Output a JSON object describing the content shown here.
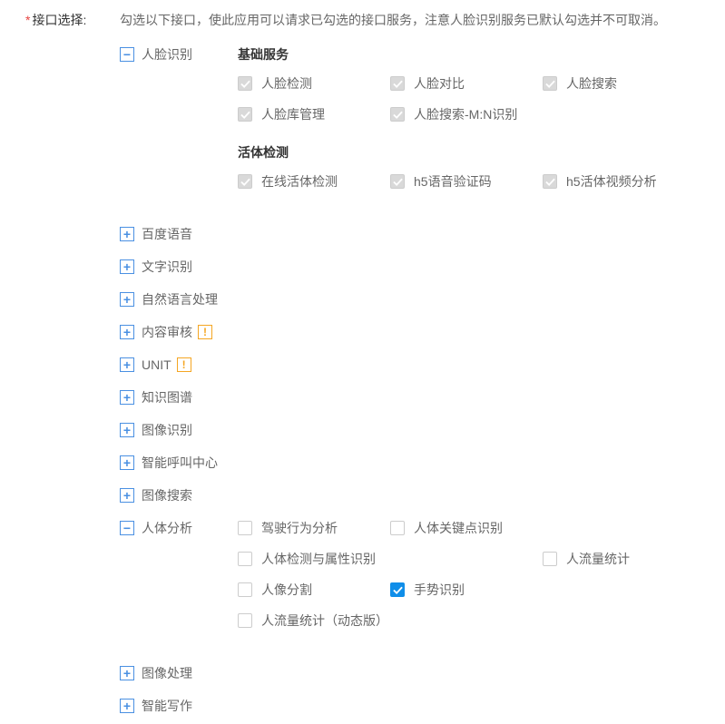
{
  "label": "接口选择:",
  "description": "勾选以下接口，使此应用可以请求已勾选的接口服务，注意人脸识别服务已默认勾选并不可取消。",
  "categories": [
    {
      "name": "人脸识别",
      "expanded": true,
      "warn": false,
      "groups": [
        {
          "title": "基础服务",
          "options": [
            {
              "label": "人脸检测",
              "state": "disabled-checked",
              "wide": false
            },
            {
              "label": "人脸对比",
              "state": "disabled-checked",
              "wide": false
            },
            {
              "label": "人脸搜索",
              "state": "disabled-checked",
              "wide": false
            },
            {
              "label": "人脸库管理",
              "state": "disabled-checked",
              "wide": false
            },
            {
              "label": "人脸搜索-M:N识别",
              "state": "disabled-checked",
              "wide": false
            }
          ]
        },
        {
          "title": "活体检测",
          "options": [
            {
              "label": "在线活体检测",
              "state": "disabled-checked",
              "wide": false
            },
            {
              "label": "h5语音验证码",
              "state": "disabled-checked",
              "wide": false
            },
            {
              "label": "h5活体视频分析",
              "state": "disabled-checked",
              "wide": false
            }
          ]
        }
      ]
    },
    {
      "name": "百度语音",
      "expanded": false,
      "warn": false,
      "groups": []
    },
    {
      "name": "文字识别",
      "expanded": false,
      "warn": false,
      "groups": []
    },
    {
      "name": "自然语言处理",
      "expanded": false,
      "warn": false,
      "groups": []
    },
    {
      "name": "内容审核",
      "expanded": false,
      "warn": true,
      "groups": []
    },
    {
      "name": "UNIT",
      "expanded": false,
      "warn": true,
      "groups": []
    },
    {
      "name": "知识图谱",
      "expanded": false,
      "warn": false,
      "groups": []
    },
    {
      "name": "图像识别",
      "expanded": false,
      "warn": false,
      "groups": []
    },
    {
      "name": "智能呼叫中心",
      "expanded": false,
      "warn": false,
      "groups": []
    },
    {
      "name": "图像搜索",
      "expanded": false,
      "warn": false,
      "groups": []
    },
    {
      "name": "人体分析",
      "expanded": true,
      "warn": false,
      "groups": [
        {
          "title": "",
          "options": [
            {
              "label": "驾驶行为分析",
              "state": "unchecked",
              "wide": false
            },
            {
              "label": "人体关键点识别",
              "state": "unchecked",
              "wide": false
            },
            {
              "label": "人体检测与属性识别",
              "state": "unchecked",
              "wide": true
            },
            {
              "label": "人流量统计",
              "state": "unchecked",
              "wide": false
            },
            {
              "label": "人像分割",
              "state": "unchecked",
              "wide": false
            },
            {
              "label": "手势识别",
              "state": "checked",
              "wide": false
            },
            {
              "label": "人流量统计（动态版）",
              "state": "unchecked",
              "wide": true
            }
          ]
        }
      ]
    },
    {
      "name": "图像处理",
      "expanded": false,
      "warn": false,
      "groups": []
    },
    {
      "name": "智能写作",
      "expanded": false,
      "warn": false,
      "groups": []
    }
  ]
}
